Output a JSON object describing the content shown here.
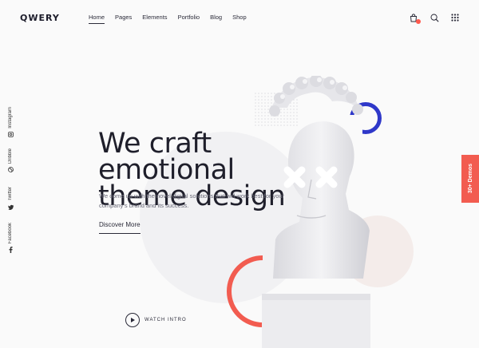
{
  "header": {
    "logo": "QWERY",
    "nav": [
      {
        "label": "Home",
        "active": true
      },
      {
        "label": "Pages"
      },
      {
        "label": "Elements"
      },
      {
        "label": "Portfolio"
      },
      {
        "label": "Blog"
      },
      {
        "label": "Shop"
      }
    ],
    "icons": [
      "cart-icon",
      "search-icon",
      "grid-menu-icon"
    ]
  },
  "social": [
    {
      "label": "Instagram",
      "icon": "instagram-icon"
    },
    {
      "label": "Dribble",
      "icon": "dribbble-icon"
    },
    {
      "label": "Twitter",
      "icon": "twitter-icon"
    },
    {
      "label": "Facebook",
      "icon": "facebook-icon"
    }
  ],
  "hero": {
    "title_line1": "We craft emotional",
    "title_line2": "theme design",
    "description": "We come up with the novel digital solutions that will work best for your company's brand and its success.",
    "cta_label": "Discover More",
    "watch_label": "WATCH INTRO"
  },
  "demos_tab": "30+ Demos",
  "colors": {
    "accent_red": "#f25c50",
    "accent_blue": "#2f38c9",
    "text_dark": "#1f1f2b"
  }
}
